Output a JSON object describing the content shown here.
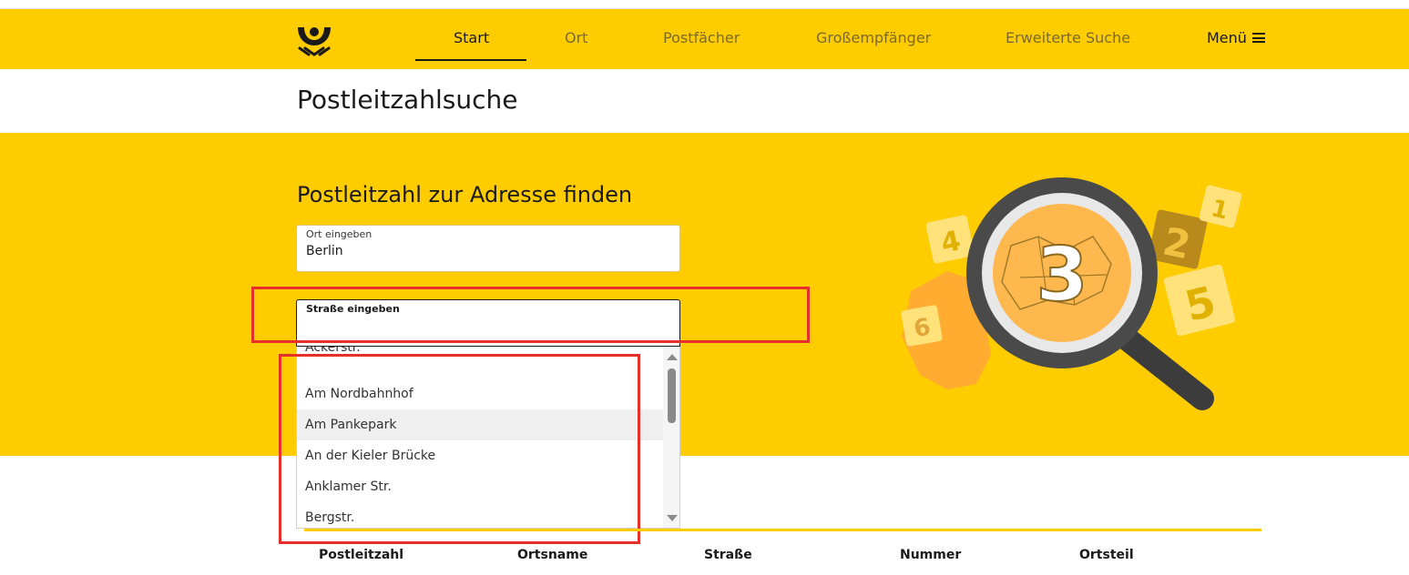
{
  "nav": {
    "items": [
      {
        "label": "Start",
        "active": true
      },
      {
        "label": "Ort",
        "active": false
      },
      {
        "label": "Postfächer",
        "active": false
      },
      {
        "label": "Großempfänger",
        "active": false
      },
      {
        "label": "Erweiterte Suche",
        "active": false
      }
    ],
    "menu_label": "Menü",
    "logo_icon": "posthorn-logo-icon",
    "menu_icon": "hamburger-icon"
  },
  "page_title": "Postleitzahlsuche",
  "hero": {
    "title": "Postleitzahl zur Adresse finden",
    "illustration_icon": "magnifier-postcode-illustration-icon",
    "illustration_numbers": [
      "4",
      "2",
      "1",
      "5",
      "6",
      "3"
    ]
  },
  "form": {
    "city": {
      "label": "Ort eingeben",
      "value": "Berlin"
    },
    "street": {
      "label": "Straße eingeben",
      "value": ""
    }
  },
  "suggestions": [
    "Ackerstr.",
    "Am Nordbahnhof",
    "Am Pankepark",
    "An der Kieler Brücke",
    "Anklamer Str.",
    "Bergstr."
  ],
  "highlighted_suggestion": "Am Pankepark",
  "results": {
    "columns": [
      "Postleitzahl",
      "Ortsname",
      "Straße",
      "Nummer",
      "Ortsteil"
    ]
  },
  "colors": {
    "brand_yellow": "#ffcc00",
    "annotation_red": "#e8302a"
  }
}
